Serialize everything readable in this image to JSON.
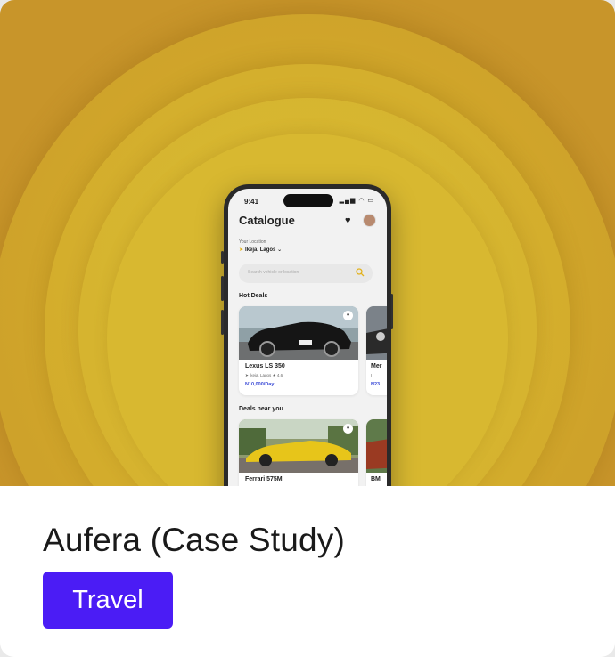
{
  "card": {
    "title": "Aufera (Case Study)",
    "tag": "Travel",
    "tag_color": "#4b1cf5",
    "hero_color": "#d8b830"
  },
  "phone": {
    "time": "9:41",
    "app_title": "Catalogue",
    "location_label": "Your Location",
    "location_value": "Ikeja, Lagos",
    "search_placeholder": "Search vehicle or location",
    "hot_deals_label": "Hot Deals",
    "deals_near_label": "Deals near you",
    "hot_deals": [
      {
        "name": "Lexus LS 350",
        "location": "Ikeja, Lagos",
        "rating": "4.6",
        "price": "N10,000/Day"
      },
      {
        "name": "Mer",
        "location": "I",
        "price": "N23"
      }
    ],
    "near_deals": [
      {
        "name": "Ferrari 575M"
      },
      {
        "name": "BM"
      }
    ]
  }
}
